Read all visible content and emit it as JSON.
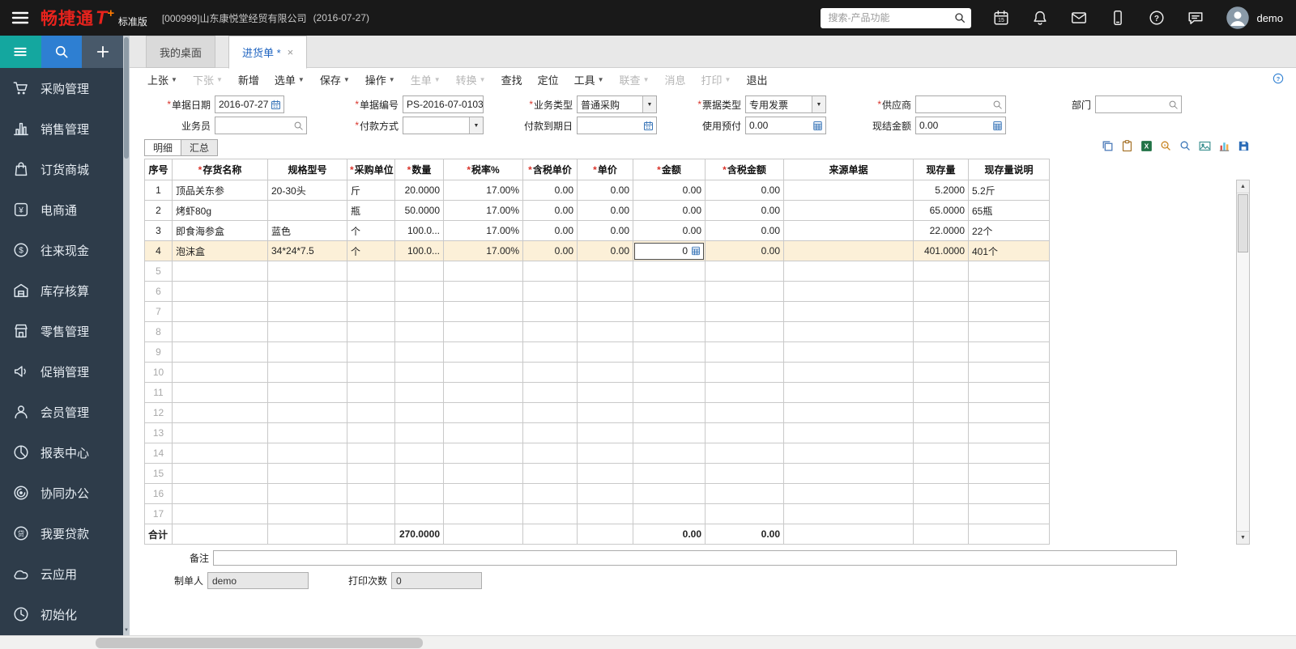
{
  "topbar": {
    "brand": "畅捷通",
    "brand_t": "T",
    "brand_plus": "+",
    "edition": "标准版",
    "company": "[000999]山东康悦堂经贸有限公司",
    "date": "(2016-07-27)",
    "search_placeholder": "搜索-产品功能",
    "icons": [
      "calendar-icon",
      "bell-icon",
      "mail-icon",
      "mobile-icon",
      "help-icon",
      "chat-icon"
    ],
    "user": "demo"
  },
  "sidebar": {
    "tiles": [
      {
        "id": "menu",
        "icon": "hamburger-teal-icon"
      },
      {
        "id": "search",
        "icon": "search-icon"
      },
      {
        "id": "add",
        "icon": "plus-icon"
      }
    ],
    "items": [
      {
        "id": "purchase",
        "icon": "cart-icon",
        "label": "采购管理"
      },
      {
        "id": "sales",
        "icon": "bar-chart-icon",
        "label": "销售管理"
      },
      {
        "id": "mall",
        "icon": "mall-icon",
        "label": "订货商城"
      },
      {
        "id": "ecommerce",
        "icon": "ecommerce-icon",
        "label": "电商通"
      },
      {
        "id": "cash",
        "icon": "cash-icon",
        "label": "往来现金"
      },
      {
        "id": "inventory",
        "icon": "warehouse-icon",
        "label": "库存核算"
      },
      {
        "id": "retail",
        "icon": "retail-icon",
        "label": "零售管理"
      },
      {
        "id": "promotion",
        "icon": "promotion-icon",
        "label": "促销管理"
      },
      {
        "id": "member",
        "icon": "member-icon",
        "label": "会员管理"
      },
      {
        "id": "report",
        "icon": "report-icon",
        "label": "报表中心"
      },
      {
        "id": "collaboration",
        "icon": "collaboration-icon",
        "label": "协同办公"
      },
      {
        "id": "loan",
        "icon": "loan-icon",
        "label": "我要贷款"
      },
      {
        "id": "cloud",
        "icon": "cloud-icon",
        "label": "云应用"
      },
      {
        "id": "init",
        "icon": "init-icon",
        "label": "初始化"
      }
    ]
  },
  "tabs": [
    {
      "id": "desktop",
      "label": "我的桌面",
      "active": false
    },
    {
      "id": "purchase-order",
      "label": "进货单 *",
      "active": true,
      "closable": true
    }
  ],
  "toolbar": {
    "items": [
      {
        "id": "prev",
        "label": "上张",
        "dropdown": true,
        "enabled": true
      },
      {
        "id": "next",
        "label": "下张",
        "dropdown": true,
        "enabled": false
      },
      {
        "id": "add",
        "label": "新增",
        "dropdown": false,
        "enabled": true
      },
      {
        "id": "pick",
        "label": "选单",
        "dropdown": true,
        "enabled": true
      },
      {
        "id": "save",
        "label": "保存",
        "dropdown": true,
        "enabled": true
      },
      {
        "id": "action",
        "label": "操作",
        "dropdown": true,
        "enabled": true
      },
      {
        "id": "generate",
        "label": "生单",
        "dropdown": true,
        "enabled": false
      },
      {
        "id": "convert",
        "label": "转换",
        "dropdown": true,
        "enabled": false
      },
      {
        "id": "find",
        "label": "查找",
        "dropdown": false,
        "enabled": true
      },
      {
        "id": "locate",
        "label": "定位",
        "dropdown": false,
        "enabled": true
      },
      {
        "id": "tools",
        "label": "工具",
        "dropdown": true,
        "enabled": true
      },
      {
        "id": "link",
        "label": "联查",
        "dropdown": true,
        "enabled": false
      },
      {
        "id": "message",
        "label": "消息",
        "dropdown": false,
        "enabled": false
      },
      {
        "id": "print",
        "label": "打印",
        "dropdown": true,
        "enabled": false
      },
      {
        "id": "exit",
        "label": "退出",
        "dropdown": false,
        "enabled": true
      }
    ]
  },
  "form": {
    "fields": [
      {
        "id": "doc-date",
        "label": "单据日期",
        "required": true,
        "value": "2016-07-27",
        "icon": "field-calendar-icon"
      },
      {
        "id": "doc-no",
        "label": "单据编号",
        "required": true,
        "value": "PS-2016-07-0103",
        "icon": "none"
      },
      {
        "id": "biz-type",
        "label": "业务类型",
        "required": true,
        "value": "普通采购",
        "icon": "dropdown"
      },
      {
        "id": "invoice-type",
        "label": "票据类型",
        "required": true,
        "value": "专用发票",
        "icon": "dropdown"
      },
      {
        "id": "supplier",
        "label": "供应商",
        "required": true,
        "value": "",
        "icon": "magnifier-icon"
      },
      {
        "id": "department",
        "label": "部门",
        "required": false,
        "value": "",
        "icon": "magnifier-icon"
      },
      {
        "id": "salesman",
        "label": "业务员",
        "required": false,
        "value": "",
        "icon": "magnifier-icon"
      },
      {
        "id": "pay-method",
        "label": "付款方式",
        "required": true,
        "value": "",
        "icon": "dropdown"
      },
      {
        "id": "pay-due-date",
        "label": "付款到期日",
        "required": false,
        "value": "",
        "icon": "field-calendar-icon"
      },
      {
        "id": "prepaid",
        "label": "使用预付",
        "required": false,
        "value": "0.00",
        "icon": "calculator-icon"
      },
      {
        "id": "cash-amount",
        "label": "现结金额",
        "required": false,
        "value": "0.00",
        "icon": "calculator-icon"
      }
    ]
  },
  "detail_tabs": [
    {
      "id": "detail",
      "label": "明细",
      "active": true
    },
    {
      "id": "summary",
      "label": "汇总",
      "active": false
    }
  ],
  "grid": {
    "tools": [
      "copy-icon",
      "paste-icon",
      "excel-export-icon",
      "price-search-icon",
      "zoom-icon",
      "image-icon",
      "chart-icon",
      "save-layout-icon"
    ],
    "columns": [
      {
        "id": "seq",
        "label": "序号",
        "required": false,
        "align": "center"
      },
      {
        "id": "item-name",
        "label": "存货名称",
        "required": true,
        "align": "left"
      },
      {
        "id": "spec",
        "label": "规格型号",
        "required": false,
        "align": "left"
      },
      {
        "id": "unit",
        "label": "采购单位",
        "required": true,
        "align": "left"
      },
      {
        "id": "qty",
        "label": "数量",
        "required": true,
        "align": "right"
      },
      {
        "id": "tax-rate",
        "label": "税率%",
        "required": true,
        "align": "right"
      },
      {
        "id": "price-incl-tax",
        "label": "含税单价",
        "required": true,
        "align": "right"
      },
      {
        "id": "price",
        "label": "单价",
        "required": true,
        "align": "right"
      },
      {
        "id": "amount",
        "label": "金额",
        "required": true,
        "align": "right"
      },
      {
        "id": "amount-incl-tax",
        "label": "含税金额",
        "required": true,
        "align": "right"
      },
      {
        "id": "source-doc",
        "label": "来源单据",
        "required": false,
        "align": "left"
      },
      {
        "id": "stock-qty",
        "label": "现存量",
        "required": false,
        "align": "right"
      },
      {
        "id": "stock-desc",
        "label": "现存量说明",
        "required": false,
        "align": "left"
      }
    ],
    "rows": [
      {
        "cells": [
          "1",
          "顶品关东参",
          "20-30头",
          "斤",
          "20.0000",
          "17.00%",
          "0.00",
          "0.00",
          "0.00",
          "0.00",
          "",
          "5.2000",
          "5.2斤"
        ],
        "highlight": false
      },
      {
        "cells": [
          "2",
          "烤虾80g",
          "",
          "瓶",
          "50.0000",
          "17.00%",
          "0.00",
          "0.00",
          "0.00",
          "0.00",
          "",
          "65.0000",
          "65瓶"
        ],
        "highlight": false
      },
      {
        "cells": [
          "3",
          "即食海参盒",
          "蓝色",
          "个",
          "100.0...",
          "17.00%",
          "0.00",
          "0.00",
          "0.00",
          "0.00",
          "",
          "22.0000",
          "22个"
        ],
        "highlight": false
      },
      {
        "cells": [
          "4",
          "泡沫盒",
          "34*24*7.5",
          "个",
          "100.0...",
          "17.00%",
          "0.00",
          "0.00",
          "0",
          "0.00",
          "",
          "401.0000",
          "401个"
        ],
        "highlight": true,
        "editing_col": 8
      }
    ],
    "empty_row_numbers": [
      5,
      6,
      7,
      8,
      9,
      10,
      11,
      12,
      13,
      14,
      15,
      16,
      17
    ],
    "total": {
      "cells": [
        "合计",
        "",
        "",
        "",
        "270.0000",
        "",
        "",
        "",
        "0.00",
        "0.00",
        "",
        "",
        ""
      ]
    }
  },
  "footer": {
    "remark_label": "备注",
    "remark_value": "",
    "creator_label": "制单人",
    "creator_value": "demo",
    "print_label": "打印次数",
    "print_value": "0"
  },
  "colors": {
    "brand_red": "#e8231d",
    "topbar_bg": "#191919",
    "sidebar_bg": "#2e3c4a",
    "tile_teal": "#14a79f",
    "tile_blue": "#2e7fd2",
    "tile_gray": "#48596a",
    "active_tab_text": "#1f64c0",
    "highlight_row": "#fcf0d8",
    "disabled_text": "#b5b5b5",
    "required_star": "#d9342b",
    "excel_green": "#217346",
    "save_blue": "#2b6cb8"
  }
}
